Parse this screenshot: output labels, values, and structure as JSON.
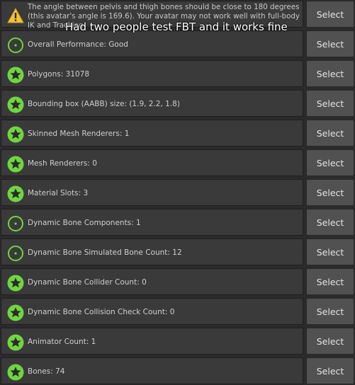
{
  "select_label": "Select",
  "overlay_caption": "Had two people test FBT and it works fine",
  "colors": {
    "good_green": "#6fd63f",
    "warning_yellow": "#f2c236",
    "panel": "#3a3a3a",
    "button": "#515151"
  },
  "rows": [
    {
      "icon": "warning-icon",
      "text": "The angle between pelvis and thigh bones should be close to 180 degrees (this avatar's angle is 169.6). Your avatar may not work well with full-body IK and Tracking."
    },
    {
      "icon": "good-circle-icon",
      "text": "Overall Performance: Good"
    },
    {
      "icon": "star-icon",
      "text": "Polygons: 31078"
    },
    {
      "icon": "star-icon",
      "text": "Bounding box (AABB) size: (1.9, 2.2, 1.8)"
    },
    {
      "icon": "star-icon",
      "text": "Skinned Mesh Renderers: 1"
    },
    {
      "icon": "star-icon",
      "text": "Mesh Renderers: 0"
    },
    {
      "icon": "star-icon",
      "text": "Material Slots: 3"
    },
    {
      "icon": "good-circle-icon",
      "text": "Dynamic Bone Components: 1"
    },
    {
      "icon": "good-circle-icon",
      "text": "Dynamic Bone Simulated Bone Count: 12"
    },
    {
      "icon": "star-icon",
      "text": "Dynamic Bone Collider Count: 0"
    },
    {
      "icon": "star-icon",
      "text": "Dynamic Bone Collision Check Count: 0"
    },
    {
      "icon": "star-icon",
      "text": "Animator Count: 1"
    },
    {
      "icon": "star-icon",
      "text": "Bones: 74"
    }
  ]
}
